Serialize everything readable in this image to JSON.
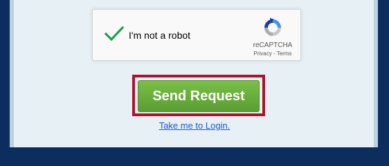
{
  "recaptcha": {
    "checkbox_label": "I'm not a robot",
    "checked": true,
    "brand": "reCAPTCHA",
    "privacy_link": "Privacy",
    "separator": " - ",
    "terms_link": "Terms",
    "check_color": "#1e9e4f",
    "icon": "recaptcha-logo-icon"
  },
  "form": {
    "submit_label": "Send Request",
    "login_link": "Take me to Login."
  },
  "colors": {
    "page_background": "#0d2d5e",
    "panel_background": "#e7f1f5",
    "button_green": "#6aad3b",
    "highlight_border": "#b0112b",
    "link_blue": "#1a56d6"
  }
}
